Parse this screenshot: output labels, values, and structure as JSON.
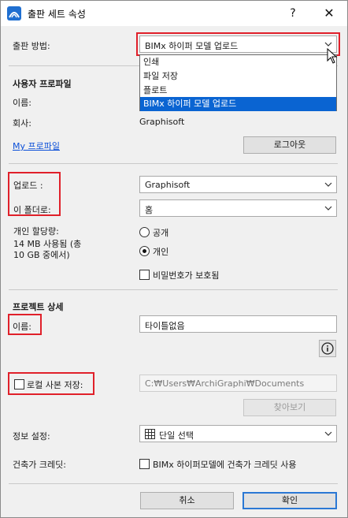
{
  "window": {
    "title": "출판 세트 속성",
    "help": "?",
    "close": "✕"
  },
  "publish_method": {
    "label": "출판 방법:",
    "selected": "BIMx 하이퍼 모델 업로드",
    "options": [
      "인쇄",
      "파일 저장",
      "플로트",
      "BIMx 하이퍼 모델 업로드"
    ]
  },
  "user_profile": {
    "heading": "사용자 프로파일",
    "name_label": "이름:",
    "company_label": "회사:",
    "company_value": "Graphisoft",
    "my_profile_link": "My 프로파일",
    "logout_button": "로그아웃"
  },
  "upload": {
    "upload_label": "업로드 :",
    "upload_value": "Graphisoft",
    "folder_label": "이 폴더로:",
    "folder_value": "홈",
    "quota_label": "개인 할당량:",
    "quota_detail_line1": "14 MB  사용됨 (총",
    "quota_detail_line2": "10 GB 중에서)",
    "radio_public": "공개",
    "radio_private": "개인",
    "password_checkbox": "비밀번호가 보호됨"
  },
  "project": {
    "heading": "프로젝트 상세",
    "name_label": "이름:",
    "name_value": "타이틀없음",
    "local_copy_label": "로컬 사본 저장:",
    "path_value": "C:₩Users₩ArchiGraphi₩Documents",
    "browse_button": "찾아보기",
    "info_setting_label": "정보 설정:",
    "info_setting_value": "단일 선택",
    "architect_credit_label": "건축가 크레딧:",
    "architect_credit_checkbox": "BIMx 하이퍼모델에 건축가 크레딧 사용"
  },
  "footer": {
    "cancel_button": "취소",
    "ok_button": "확인"
  },
  "colors": {
    "highlight_border": "#e0202a",
    "selection_blue": "#0a64d2",
    "link_blue": "#0b4fd8",
    "primary_button_border": "#2b78d4"
  }
}
